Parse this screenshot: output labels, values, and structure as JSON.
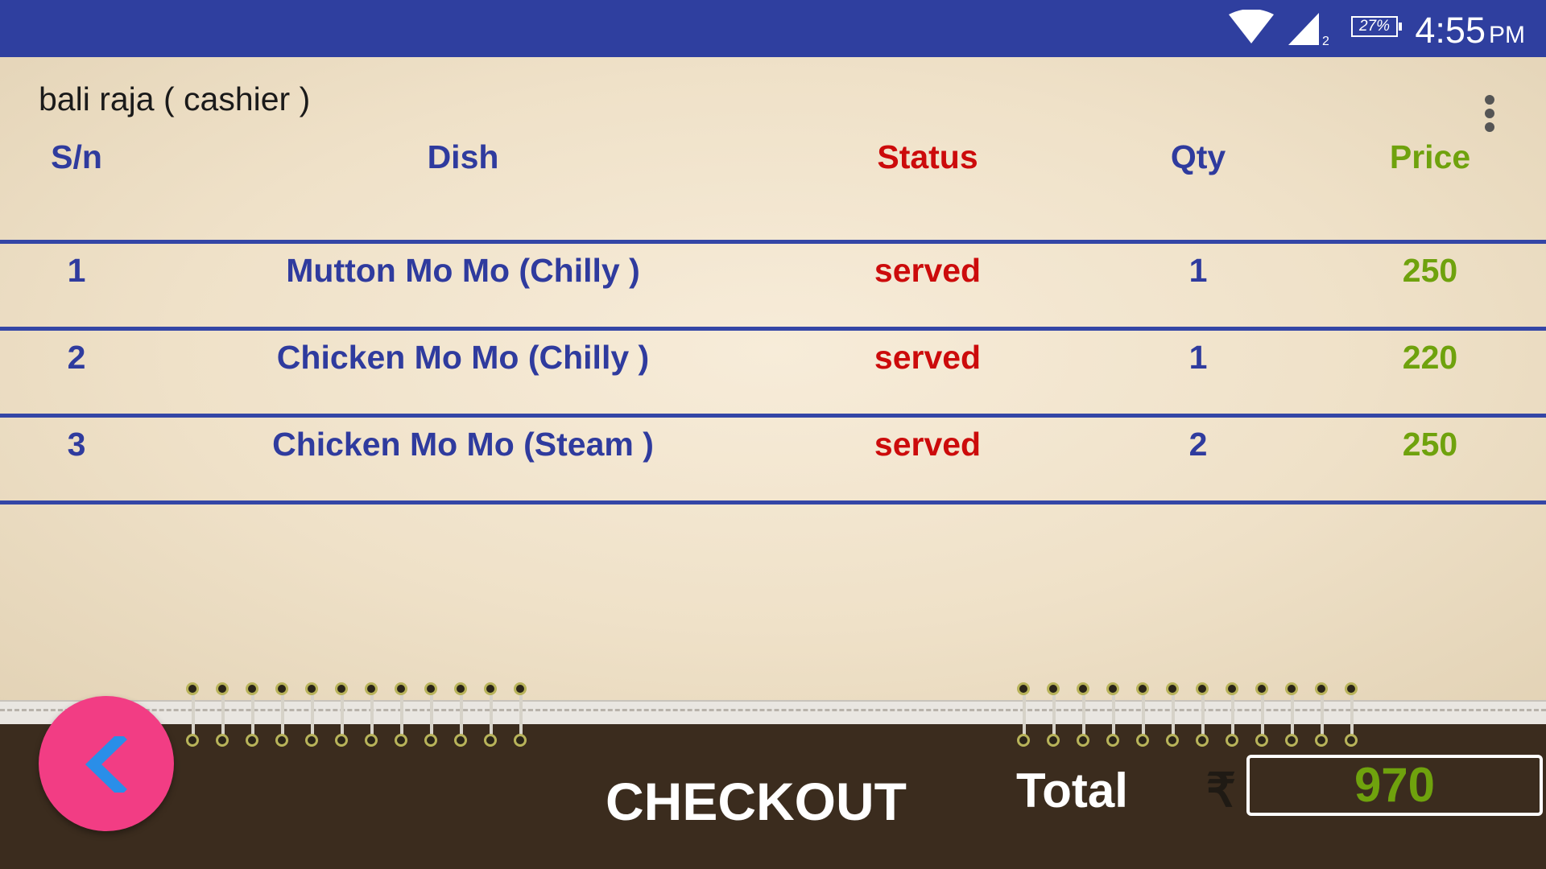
{
  "status_bar": {
    "battery": "27%",
    "time": "4:55",
    "ampm": "PM",
    "sim_slot": "2"
  },
  "header": {
    "user": "bali raja ( cashier )"
  },
  "table": {
    "columns": [
      "S/n",
      "Dish",
      "Status",
      "Qty",
      "Price"
    ],
    "rows": [
      {
        "sn": "1",
        "dish": "Mutton Mo Mo (Chilly )",
        "status": "served",
        "qty": "1",
        "price": "250"
      },
      {
        "sn": "2",
        "dish": "Chicken Mo Mo (Chilly )",
        "status": "served",
        "qty": "1",
        "price": "220"
      },
      {
        "sn": "3",
        "dish": "Chicken Mo Mo (Steam )",
        "status": "served",
        "qty": "2",
        "price": "250"
      }
    ]
  },
  "footer": {
    "checkout_label": "CHECKOUT",
    "total_label": "Total",
    "currency_symbol": "₹",
    "total_value": "970"
  },
  "icons": {
    "back": "chevron-left-icon",
    "menu": "more-vert-icon"
  },
  "colors": {
    "status_bar": "#2f3f9f",
    "header_blue": "#2f3b9e",
    "status_red": "#cc0b0b",
    "price_green": "#6fa20d",
    "fab": "#f23d84",
    "bottom_bar": "#3b2c1e"
  }
}
